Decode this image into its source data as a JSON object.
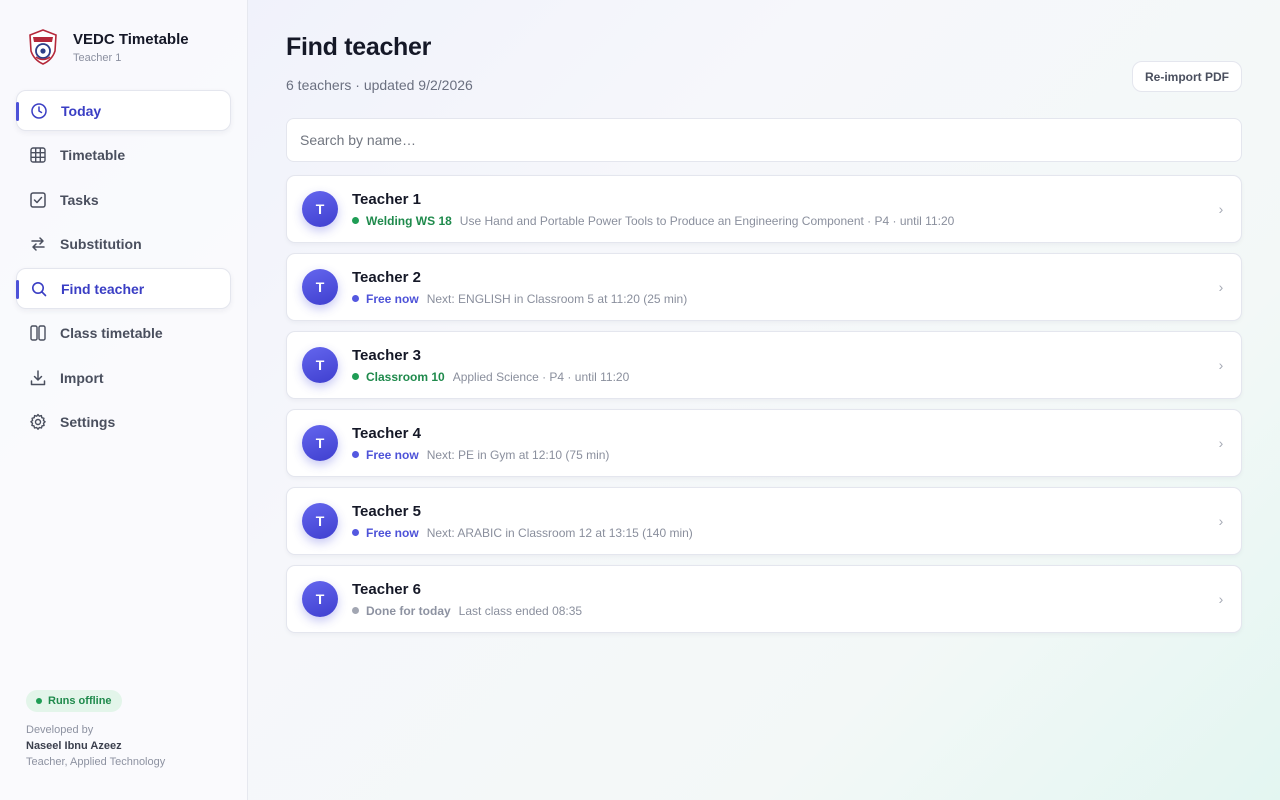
{
  "app": {
    "title": "VEDC Timetable",
    "subtitle": "Teacher 1"
  },
  "nav": [
    {
      "label": "Today",
      "icon": "clock-icon",
      "active": true
    },
    {
      "label": "Timetable",
      "icon": "grid-icon",
      "active": false
    },
    {
      "label": "Tasks",
      "icon": "checkbox-icon",
      "active": false
    },
    {
      "label": "Substitution",
      "icon": "swap-icon",
      "active": false
    },
    {
      "label": "Find teacher",
      "icon": "search-icon",
      "active": true
    },
    {
      "label": "Class timetable",
      "icon": "columns-icon",
      "active": false
    },
    {
      "label": "Import",
      "icon": "download-icon",
      "active": false
    },
    {
      "label": "Settings",
      "icon": "gear-icon",
      "active": false
    }
  ],
  "footer": {
    "badge": "Runs offline",
    "developed_by": "Developed by",
    "developer": "Naseel Ibnu Azeez",
    "role": "Teacher, Applied Technology"
  },
  "main": {
    "title": "Find teacher",
    "subtitle": "6 teachers · updated 9/2/2026",
    "reimport_label": "Re-import PDF",
    "search_placeholder": "Search by name…"
  },
  "teachers": [
    {
      "initial": "T",
      "name": "Teacher 1",
      "state": "busy",
      "label": "Welding WS 18",
      "detail": "Use Hand and Portable Power Tools to Produce an Engineering Component · P4 · until 11:20"
    },
    {
      "initial": "T",
      "name": "Teacher 2",
      "state": "free",
      "label": "Free now",
      "detail": "Next: ENGLISH in Classroom 5 at 11:20 (25 min)"
    },
    {
      "initial": "T",
      "name": "Teacher 3",
      "state": "busy",
      "label": "Classroom 10",
      "detail": "Applied Science · P4 · until 11:20"
    },
    {
      "initial": "T",
      "name": "Teacher 4",
      "state": "free",
      "label": "Free now",
      "detail": "Next: PE in Gym at 12:10 (75 min)"
    },
    {
      "initial": "T",
      "name": "Teacher 5",
      "state": "free",
      "label": "Free now",
      "detail": "Next: ARABIC in Classroom 12 at 13:15 (140 min)"
    },
    {
      "initial": "T",
      "name": "Teacher 6",
      "state": "done",
      "label": "Done for today",
      "detail": "Last class ended 08:35"
    }
  ],
  "colors": {
    "accent": "#4d52d8",
    "busy": "#1f9d55",
    "free": "#5458e0",
    "done": "#a2a6b2"
  }
}
